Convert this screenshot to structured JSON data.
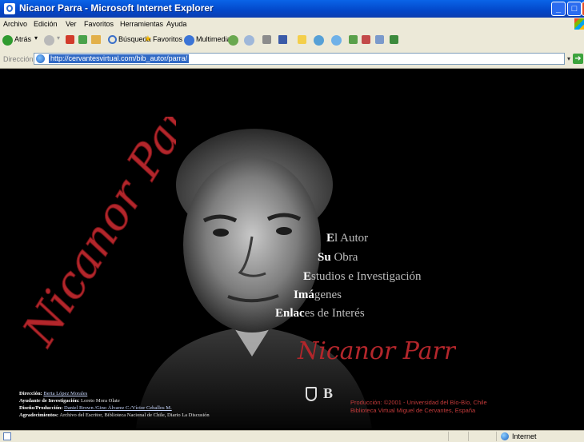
{
  "window": {
    "title": "Nicanor Parra - Microsoft Internet Explorer"
  },
  "menubar": {
    "items": [
      "Archivo",
      "Edición",
      "Ver",
      "Favoritos",
      "Herramientas",
      "Ayuda"
    ]
  },
  "toolbar": {
    "back_label": "Atrás",
    "search_label": "Búsqueda",
    "favorites_label": "Favoritos",
    "media_label": "Multimedia"
  },
  "address": {
    "label": "Dirección",
    "url": "http://cervantesvirtual.com/bib_autor/parra/",
    "go_label": "Ir"
  },
  "page": {
    "script_title": "Nicanor Parra",
    "signature": "Nicanor Parra",
    "nav": [
      {
        "first": "E",
        "rest": "l Autor"
      },
      {
        "first": "Su",
        "rest": " Obra"
      },
      {
        "first": "E",
        "rest": "studios e Investigación",
        "bold_extra": "studi"
      },
      {
        "first": "Imá",
        "rest": "genes"
      },
      {
        "first": "Enlac",
        "rest": "es de Interés"
      }
    ],
    "nav_full": [
      "El Autor",
      "Su Obra",
      "Estudios e Investigación",
      "Imágenes",
      "Enlaces de Interés"
    ],
    "credits": [
      {
        "key": "Dirección:",
        "value": "Berta López Morales",
        "link": true
      },
      {
        "key": "Ayudante de Investigación:",
        "value": "Loreto Mora Olate",
        "link": false
      },
      {
        "key": "Diseño/Producción:",
        "value": "Daniel Brown /Gino Álvarez C./Víctor Ceballos M.",
        "link": true
      },
      {
        "key": "Agradecimientos:",
        "value": "Archivo del Escritor, Biblioteca Nacional de Chile, Diario La Discusión",
        "link": false
      }
    ],
    "production_line1": "Producción: ©2001 - Universidad del Bío-Bío, Chile",
    "production_line2": "Biblioteca Virtual Miguel de Cervantes, España",
    "logo_text": "B"
  },
  "statusbar": {
    "zone": "Internet"
  },
  "colors": {
    "signature": "#b3262b",
    "production": "#c33a3a",
    "titlebar": "#0a5ae0"
  }
}
